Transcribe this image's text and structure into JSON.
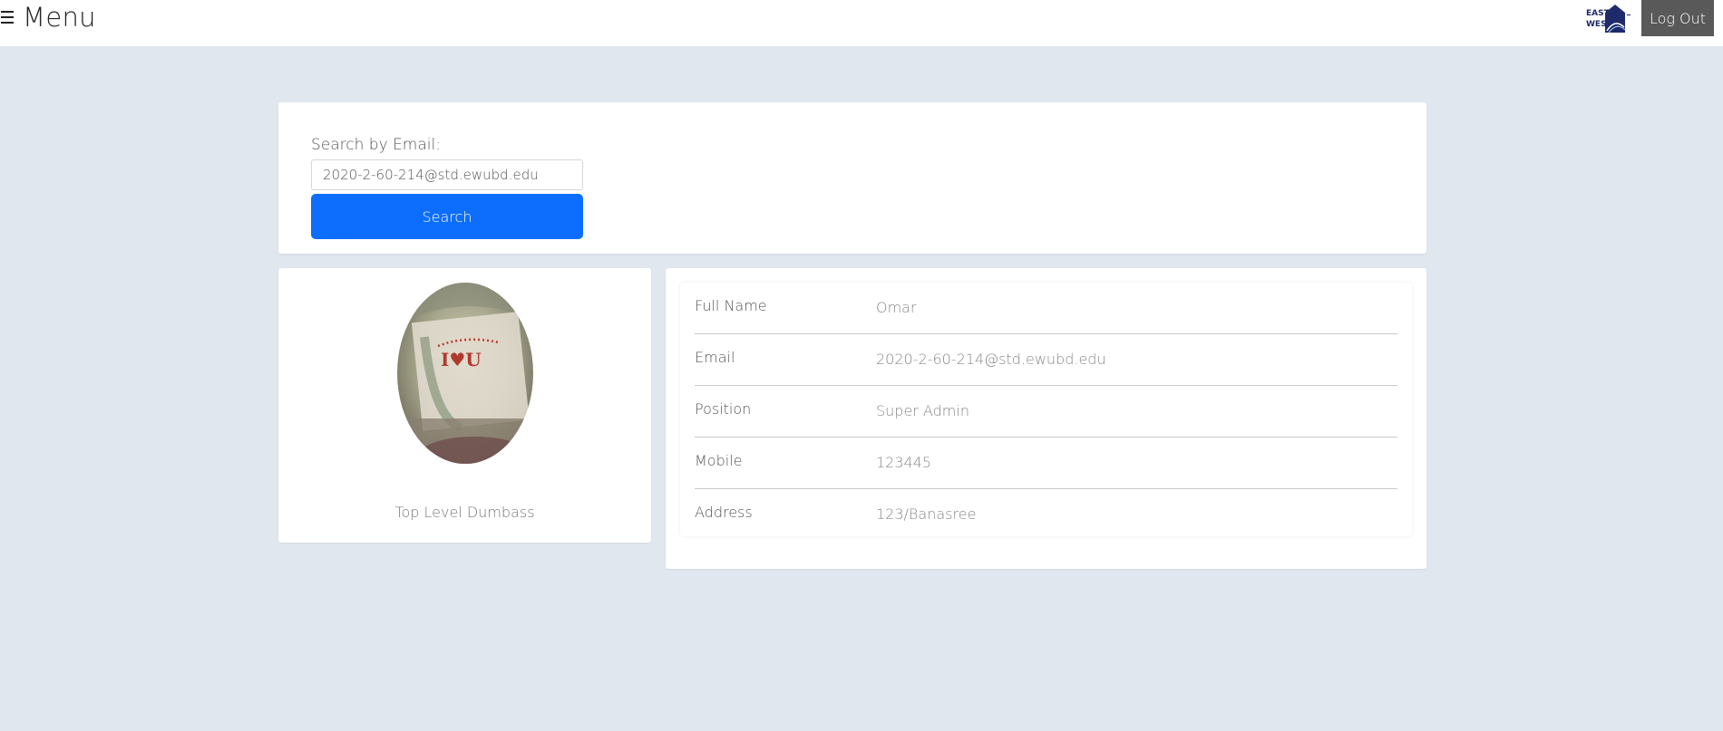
{
  "header": {
    "menu_label": "Menu",
    "menu_icon": "hamburger-icon",
    "logo_icon": "east-west-university-logo",
    "logout_label": "Log Out"
  },
  "search": {
    "label": "Search by Email:",
    "value": "2020-2-60-214@std.ewubd.edu",
    "button_label": "Search"
  },
  "profile": {
    "caption": "Top Level Dumbass"
  },
  "details": {
    "rows": [
      {
        "label": "Full Name",
        "value": "Omar"
      },
      {
        "label": "Email",
        "value": "2020-2-60-214@std.ewubd.edu"
      },
      {
        "label": "Position",
        "value": "Super Admin"
      },
      {
        "label": "Mobile",
        "value": "123445"
      },
      {
        "label": "Address",
        "value": "123/Banasree"
      }
    ]
  },
  "colors": {
    "page_bg": "#e1e7ef",
    "primary": "#0d6efd",
    "logout_bg": "#595959"
  }
}
